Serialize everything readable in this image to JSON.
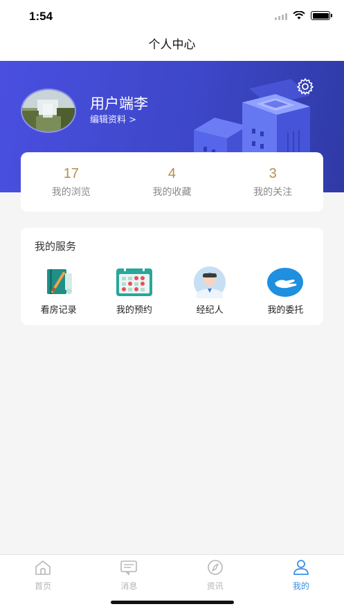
{
  "status_bar": {
    "time": "1:54"
  },
  "nav": {
    "title": "个人中心"
  },
  "profile": {
    "name": "用户端李",
    "edit_label": "编辑资料 >"
  },
  "stats": [
    {
      "value": "17",
      "label": "我的浏览"
    },
    {
      "value": "4",
      "label": "我的收藏"
    },
    {
      "value": "3",
      "label": "我的关注"
    }
  ],
  "services": {
    "title": "我的服务",
    "items": [
      {
        "label": "看房记录",
        "icon": "notebook-pen-icon"
      },
      {
        "label": "我的预约",
        "icon": "calendar-icon"
      },
      {
        "label": "经纪人",
        "icon": "agent-avatar-icon"
      },
      {
        "label": "我的委托",
        "icon": "handshake-icon"
      }
    ]
  },
  "tab_bar": {
    "tabs": [
      {
        "label": "首页",
        "icon": "home-icon",
        "active": false
      },
      {
        "label": "消息",
        "icon": "message-icon",
        "active": false
      },
      {
        "label": "资讯",
        "icon": "compass-icon",
        "active": false
      },
      {
        "label": "我的",
        "icon": "user-icon",
        "active": true
      }
    ]
  },
  "colors": {
    "hero": "#4a4fe0",
    "accent": "#3a8ee6",
    "stat_number": "#b38d4f"
  }
}
